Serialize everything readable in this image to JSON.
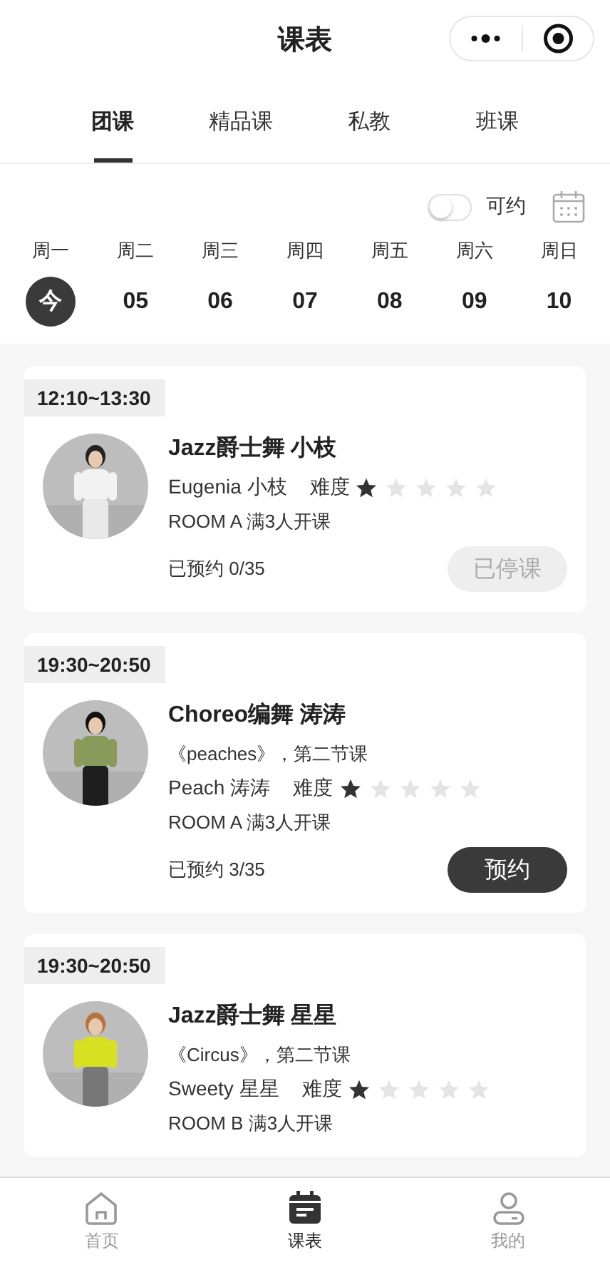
{
  "header": {
    "title": "课表"
  },
  "tabs": [
    {
      "label": "团课",
      "selected": true
    },
    {
      "label": "精品课",
      "selected": false
    },
    {
      "label": "私教",
      "selected": false
    },
    {
      "label": "班课",
      "selected": false
    }
  ],
  "filter": {
    "toggle_on": false,
    "label": "可约"
  },
  "week": [
    {
      "weekday": "周一",
      "date": "今",
      "selected": true
    },
    {
      "weekday": "周二",
      "date": "05",
      "selected": false
    },
    {
      "weekday": "周三",
      "date": "06",
      "selected": false
    },
    {
      "weekday": "周四",
      "date": "07",
      "selected": false
    },
    {
      "weekday": "周五",
      "date": "08",
      "selected": false
    },
    {
      "weekday": "周六",
      "date": "09",
      "selected": false
    },
    {
      "weekday": "周日",
      "date": "10",
      "selected": false
    }
  ],
  "classes": [
    {
      "time": "12:10~13:30",
      "title": "Jazz爵士舞 小枝",
      "teacher": "Eugenia 小枝",
      "difficulty_label": "难度",
      "stars": 1,
      "room": "ROOM A  满3人开课",
      "booked": "已预约 0/35",
      "button": {
        "kind": "stopped",
        "label": "已停课"
      }
    },
    {
      "time": "19:30~20:50",
      "title": "Choreo编舞 涛涛",
      "song": "《peaches》，第二节课",
      "teacher": "Peach 涛涛",
      "difficulty_label": "难度",
      "stars": 1,
      "room": "ROOM A  满3人开课",
      "booked": "已预约 3/35",
      "button": {
        "kind": "book",
        "label": "预约"
      }
    },
    {
      "time": "19:30~20:50",
      "title": "Jazz爵士舞 星星",
      "song": "《Circus》，第二节课",
      "teacher": "Sweety 星星",
      "difficulty_label": "难度",
      "stars": 1,
      "room": "ROOM B  满3人开课"
    }
  ],
  "bottom_nav": [
    {
      "label": "首页",
      "selected": false
    },
    {
      "label": "课表",
      "selected": true
    },
    {
      "label": "我的",
      "selected": false
    }
  ]
}
